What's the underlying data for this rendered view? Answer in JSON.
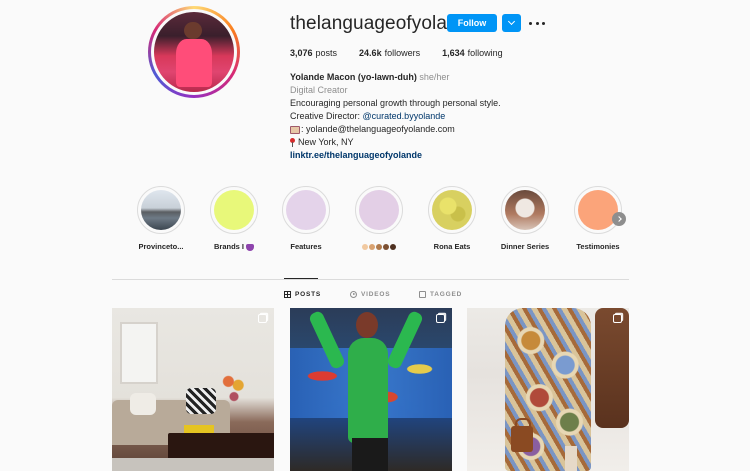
{
  "profile": {
    "username": "thelanguageofyolande",
    "follow_label": "Follow",
    "stats": [
      {
        "value": "3,076",
        "label": "posts"
      },
      {
        "value": "24.6k",
        "label": "followers"
      },
      {
        "value": "1,634",
        "label": "following"
      }
    ],
    "bio": {
      "name": "Yolande Macon (yo-lawn-duh)",
      "pronouns": "she/her",
      "category": "Digital Creator",
      "line1": "Encouraging personal growth through personal style.",
      "line2_prefix": "Creative Director: ",
      "line2_mention": "@curated.byyolande",
      "email": ": yolande@thelanguageofyolande.com",
      "location": "New York, NY",
      "link": "linktr.ee/thelanguageofyolande"
    }
  },
  "highlights": [
    {
      "label": "Provinceto..."
    },
    {
      "label": "Brands I"
    },
    {
      "label": "Features"
    },
    {
      "label": ""
    },
    {
      "label": "Rona Eats"
    },
    {
      "label": "Dinner Series"
    },
    {
      "label": "Testimonies"
    }
  ],
  "tabs": [
    {
      "label": "POSTS"
    },
    {
      "label": "VIDEOS"
    },
    {
      "label": "TAGGED"
    }
  ],
  "colors": {
    "accent": "#0095f6",
    "link": "#00376b",
    "muted": "#8e8e8e",
    "text": "#262626"
  }
}
